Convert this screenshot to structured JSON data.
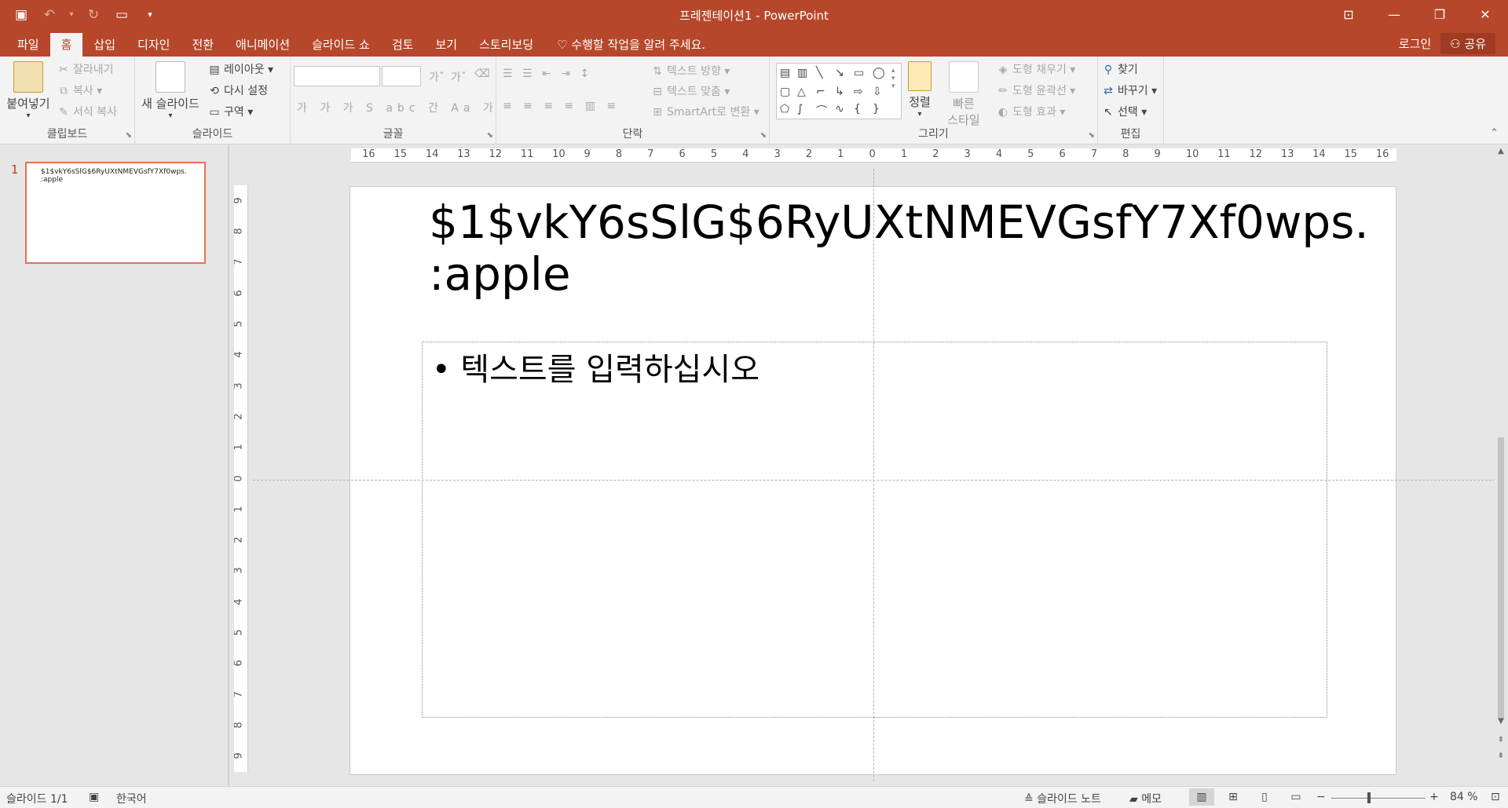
{
  "window": {
    "title": "프레젠테이션1 - PowerPoint"
  },
  "tabs": [
    {
      "label": "파일"
    },
    {
      "label": "홈"
    },
    {
      "label": "삽입"
    },
    {
      "label": "디자인"
    },
    {
      "label": "전환"
    },
    {
      "label": "애니메이션"
    },
    {
      "label": "슬라이드 쇼"
    },
    {
      "label": "검토"
    },
    {
      "label": "보기"
    },
    {
      "label": "스토리보딩"
    }
  ],
  "tell_me": "수행할 작업을 알려 주세요.",
  "signin": "로그인",
  "share": "공유",
  "ribbon": {
    "clipboard": {
      "label": "클립보드",
      "paste": "붙여넣기",
      "cut": "잘라내기",
      "copy": "복사",
      "format_painter": "서식 복사"
    },
    "slides": {
      "label": "슬라이드",
      "new_slide": "새 슬라이드",
      "layout": "레이아웃",
      "reset": "다시 설정",
      "section": "구역"
    },
    "font": {
      "label": "글꼴"
    },
    "paragraph": {
      "label": "단락",
      "text_direction": "텍스트 방향",
      "align_text": "텍스트 맞춤",
      "smartart": "SmartArt로 변환"
    },
    "drawing": {
      "label": "그리기",
      "arrange": "정렬",
      "quick_styles_1": "빠른",
      "quick_styles_2": "스타일",
      "shape_fill": "도형 채우기",
      "shape_outline": "도형 윤곽선",
      "shape_effects": "도형 효과"
    },
    "editing": {
      "label": "편집",
      "find": "찾기",
      "replace": "바꾸기",
      "select": "선택"
    }
  },
  "thumbnail": {
    "number": "1",
    "text_line1": "$1$vkY6sSlG$6RyUXtNMEVGsfY7Xf0wps.",
    "text_line2": ":apple"
  },
  "slide": {
    "title_line1": "$1$vkY6sSlG$6RyUXtNMEVGsfY7Xf0wps.",
    "title_line2": ":apple",
    "body_bullet": "• 텍스트를 입력하십시오"
  },
  "hruler_ticks": [
    "16",
    "15",
    "14",
    "13",
    "12",
    "11",
    "10",
    "9",
    "8",
    "7",
    "6",
    "5",
    "4",
    "3",
    "2",
    "1",
    "0",
    "1",
    "2",
    "3",
    "4",
    "5",
    "6",
    "7",
    "8",
    "9",
    "10",
    "11",
    "12",
    "13",
    "14",
    "15",
    "16"
  ],
  "vruler_ticks": [
    "9",
    "8",
    "7",
    "6",
    "5",
    "4",
    "3",
    "2",
    "1",
    "0",
    "1",
    "2",
    "3",
    "4",
    "5",
    "6",
    "7",
    "8",
    "9"
  ],
  "status": {
    "slide_count": "슬라이드 1/1",
    "language": "한국어",
    "notes": "슬라이드 노트",
    "comments": "메모",
    "zoom": "84 %"
  }
}
